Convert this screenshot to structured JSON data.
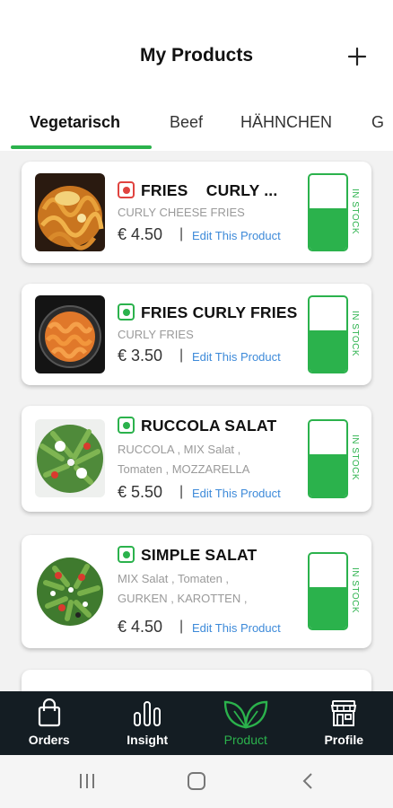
{
  "header": {
    "title": "My Products",
    "add_icon": "plus-icon"
  },
  "tabs": [
    {
      "label": "Vegetarisch",
      "active": true
    },
    {
      "label": "Beef",
      "active": false
    },
    {
      "label": "HÄHNCHEN",
      "active": false
    },
    {
      "label": "G",
      "active": false
    }
  ],
  "products": [
    {
      "name": "FRIES    CURLY ...",
      "description": "CURLY CHEESE FRIES",
      "price": "€ 4.50",
      "edit_label": "Edit This Product",
      "separator": "|",
      "stock_label": "IN STOCK",
      "in_stock": true,
      "diet_mark": "red"
    },
    {
      "name": "FRIES CURLY FRIES",
      "description": "CURLY FRIES",
      "price": "€ 3.50",
      "edit_label": "Edit This Product",
      "separator": "|",
      "stock_label": "IN STOCK",
      "in_stock": true,
      "diet_mark": "green"
    },
    {
      "name": "RUCCOLA SALAT",
      "description": "RUCCOLA , MIX Salat ,\nTomaten , MOZZARELLA",
      "price": "€ 5.50",
      "edit_label": "Edit This Product",
      "separator": "|",
      "stock_label": "IN STOCK",
      "in_stock": true,
      "diet_mark": "green"
    },
    {
      "name": "SIMPLE SALAT",
      "description": "MIX Salat , Tomaten ,\nGURKEN , KAROTTEN ,",
      "price": "€ 4.50",
      "edit_label": "Edit This Product",
      "separator": "|",
      "stock_label": "IN STOCK",
      "in_stock": true,
      "diet_mark": "green"
    }
  ],
  "bottom_nav": [
    {
      "label": "Orders",
      "icon": "shopping-bag-icon",
      "active": false
    },
    {
      "label": "Insight",
      "icon": "bar-chart-icon",
      "active": false
    },
    {
      "label": "Product",
      "icon": "leaves-icon",
      "active": true
    },
    {
      "label": "Profile",
      "icon": "store-icon",
      "active": false
    }
  ],
  "colors": {
    "accent": "#2bb24c",
    "nav_background": "#141d23",
    "link": "#3d8ad9",
    "non_veg_mark": "#e0433f"
  }
}
